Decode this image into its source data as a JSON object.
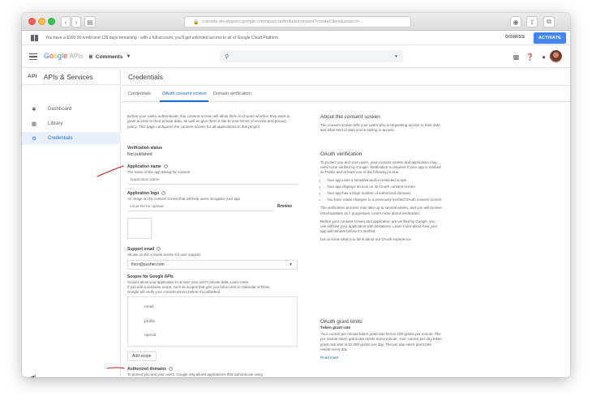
{
  "browser": {
    "address": "console.developers.google.com/apis/credentials/consent?createClient&project=..."
  },
  "banner": {
    "text": "You have a $300.00 credit and 128 days remaining - with a full account, you'll get unlimited access to all of Google Cloud Platform.",
    "dismiss": "DISMISS",
    "activate": "ACTIVATE"
  },
  "header": {
    "brand": "Google APIs",
    "project": "Comments",
    "search_placeholder": ""
  },
  "sidebar": {
    "api_badge": "API",
    "title": "APIs & Services",
    "items": [
      {
        "icon": "dashboard-icon",
        "label": "Dashboard"
      },
      {
        "icon": "library-icon",
        "label": "Library"
      },
      {
        "icon": "key-icon",
        "label": "Credentials"
      }
    ],
    "active_index": 2
  },
  "main": {
    "title": "Credentials",
    "tabs": [
      {
        "label": "Credentials"
      },
      {
        "label": "OAuth consent screen"
      },
      {
        "label": "Domain verification"
      }
    ],
    "active_tab": 1
  },
  "form": {
    "intro": "Before your users authenticate, this consent screen will allow them to choose whether they want to grant access to their private data, as well as give them a link to your terms of service and privacy policy. This page configures the consent screen for all applications in this project.",
    "verification_status_label": "Verification status",
    "verification_status_value": "Not published",
    "app_name_label": "Application name",
    "app_name_hint": "The name of the app asking for consent",
    "app_name_placeholder": "Application name",
    "app_logo_label": "Application logo",
    "app_logo_hint": "An image on the consent screen that will help users recognize your app",
    "app_logo_placeholder": "Local file for upload",
    "browse_label": "Browse",
    "support_email_label": "Support email",
    "support_email_hint": "Shown on the consent screen for user support",
    "support_email_value": "theo@pusher.com",
    "scopes_label": "Scopes for Google APIs",
    "scopes_hint_1": "Scopes allow your application to access your user's private data. Learn more",
    "scopes_hint_2": "If you add a sensitive scope, such as scopes that give you full access to Calendar or Drive,",
    "scopes_hint_3": "Google will verify your consent screen before it's published.",
    "scopes": [
      "email",
      "profile",
      "openid"
    ],
    "add_scope_label": "Add scope",
    "authorized_domains_label": "Authorized domains",
    "authorized_domains_hint": "To protect you and your users, Google only allows applications that authenticate using"
  },
  "info": {
    "about_title": "About the consent screen",
    "about_body": "The consent screen tells your users who is requesting access to their data and what kind of data you're asking to access.",
    "oauth_title": "OAuth verification",
    "oauth_body": "To protect you and your users, your consent screen and application may need to be verified by Google. Verification is required if your app is marked as Public and at least one of the following is true:",
    "oauth_list": [
      "Your app uses a sensitive and/or restricted scope",
      "Your app displays an icon on its OAuth consent screen",
      "Your app has a large number of authorized domains",
      "You have made changes to a previously-verified OAuth consent screen"
    ],
    "oauth_body_2": "The verification process may take up to several weeks, and you will receive email updates as it progresses. Learn more about verification.",
    "oauth_body_3": "Before your consent screen and application are verified by Google, you can still test your application with limitations. Learn more about how your app will behave before it's verified.",
    "oauth_body_4": "Let us know what you think about our OAuth experience.",
    "limits_title": "OAuth grant limits",
    "limits_sub": "Token grant rate",
    "limits_body": "Your current per minute token grant rate limit is 100 grants per minute. The per minute token grant rate resets every minute. Your current per day token grant rate limit is 10,000 grants per day. The per day token grant rate resets every day.",
    "read_more": "Read more"
  },
  "colors": {
    "accent": "#1967d2",
    "activate": "#4285f4",
    "annotation": "#c5221f"
  }
}
